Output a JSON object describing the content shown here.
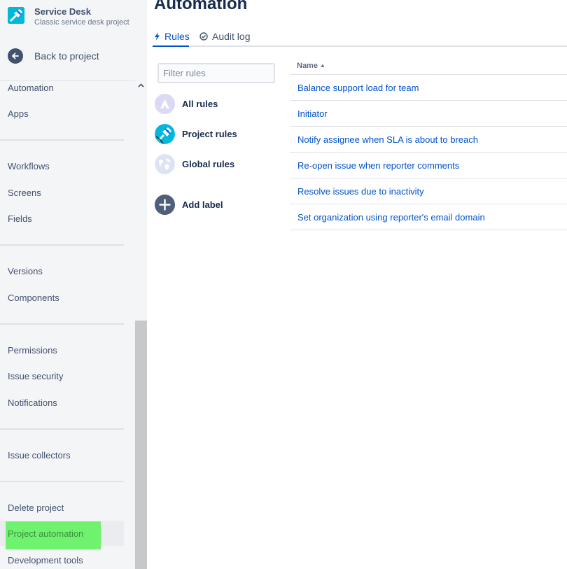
{
  "sidebar": {
    "project_name": "Service Desk",
    "project_type": "Classic service desk project",
    "back_label": "Back to project",
    "items": [
      {
        "label": "Automation"
      },
      {
        "label": "Apps"
      },
      {
        "label": "Workflows"
      },
      {
        "label": "Screens"
      },
      {
        "label": "Fields"
      },
      {
        "label": "Versions"
      },
      {
        "label": "Components"
      },
      {
        "label": "Permissions"
      },
      {
        "label": "Issue security"
      },
      {
        "label": "Notifications"
      },
      {
        "label": "Issue collectors"
      },
      {
        "label": "Delete project"
      },
      {
        "label": "Project automation"
      },
      {
        "label": "Development tools"
      }
    ],
    "highlight_color": "#6FF36F"
  },
  "main": {
    "title": "Automation",
    "tabs": [
      {
        "label": "Rules",
        "icon": "lightning-icon",
        "active": true
      },
      {
        "label": "Audit log",
        "icon": "check-circle-icon",
        "active": false
      }
    ],
    "filter": {
      "placeholder": "Filter rules",
      "value": ""
    },
    "labels": [
      {
        "label": "All rules",
        "icon": "all-rules-icon"
      },
      {
        "label": "Project rules",
        "icon": "project-rules-icon"
      },
      {
        "label": "Global rules",
        "icon": "globe-icon"
      },
      {
        "label": "Add label",
        "icon": "plus-icon"
      }
    ],
    "table": {
      "column_name": "Name",
      "sort_indicator": "▲",
      "rows": [
        "Balance support load for team",
        "Initiator",
        "Notify assignee when SLA is about to breach",
        "Re-open issue when reporter comments",
        "Resolve issues due to inactivity",
        "Set organization using reporter's email domain"
      ]
    }
  },
  "colors": {
    "link": "#0052CC",
    "text": "#172B4D",
    "sidebar_bg": "#F4F5F7",
    "accent": "#0052CC"
  }
}
